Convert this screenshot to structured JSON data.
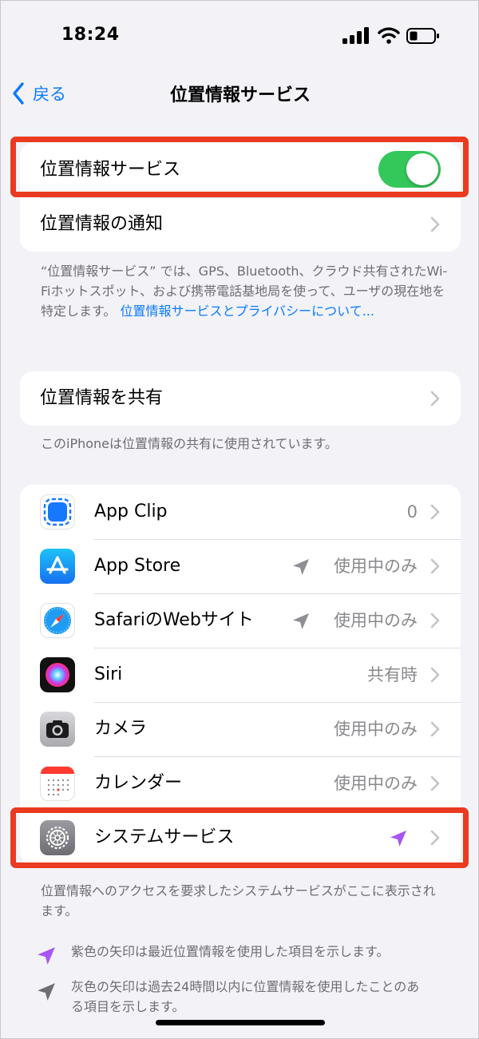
{
  "status_bar": {
    "time": "18:24"
  },
  "nav": {
    "back_label": "戻る",
    "title": "位置情報サービス"
  },
  "section1": {
    "location_services_label": "位置情報サービス",
    "location_services_enabled": true,
    "location_alerts_label": "位置情報の通知"
  },
  "footnote1": {
    "text": "“位置情報サービス” では、GPS、Bluetooth、クラウド共有されたWi-Fiホットスポット、および携帯電話基地局を使って、ユーザの現在地を特定します。",
    "link": "位置情報サービスとプライバシーについて..."
  },
  "section2": {
    "share_label": "位置情報を共有"
  },
  "footnote2": "このiPhoneは位置情報の共有に使用されています。",
  "apps": [
    {
      "name": "App Clip",
      "value": "0",
      "icon": "app-clip-icon",
      "arrow": "none"
    },
    {
      "name": "App Store",
      "value": "使用中のみ",
      "icon": "app-store-icon",
      "arrow": "gray"
    },
    {
      "name": "SafariのWebサイト",
      "value": "使用中のみ",
      "icon": "safari-icon",
      "arrow": "gray"
    },
    {
      "name": "Siri",
      "value": "共有時",
      "icon": "siri-icon",
      "arrow": "none"
    },
    {
      "name": "カメラ",
      "value": "使用中のみ",
      "icon": "camera-icon",
      "arrow": "none"
    },
    {
      "name": "カレンダー",
      "value": "使用中のみ",
      "icon": "calendar-icon",
      "arrow": "none"
    },
    {
      "name": "システムサービス",
      "value": "",
      "icon": "system-services-icon",
      "arrow": "purple"
    }
  ],
  "footnote3": "位置情報へのアクセスを要求したシステムサービスがここに表示されます。",
  "legend": {
    "purple": "紫色の矢印は最近位置情報を使用した項目を示します。",
    "gray": "灰色の矢印は過去24時間以内に位置情報を使用したことのある項目を示します。"
  },
  "colors": {
    "accent_blue": "#0A7AFF",
    "toggle_green": "#34C759",
    "highlight_red": "#EA3A1F",
    "purple_arrow": "#A855F7",
    "gray_arrow": "#8E8E93"
  }
}
